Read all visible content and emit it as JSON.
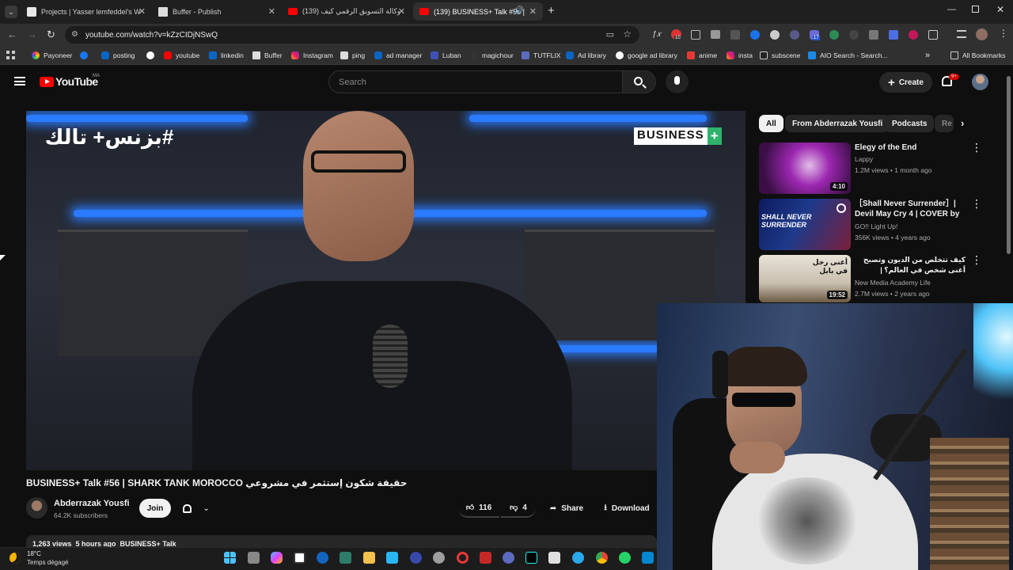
{
  "browser": {
    "tabs": [
      {
        "label": "Projects | Yasser lemfeddel's W"
      },
      {
        "label": "Buffer - Publish"
      },
      {
        "label": "(139) وكالة التسويق الرقمي كيف"
      },
      {
        "label": "(139) BUSINESS+ Talk #56 |"
      }
    ],
    "url": "youtube.com/watch?v=kZzCIDjNSwQ",
    "bookmarks": [
      "Payoneer",
      "posting",
      "youtube",
      "linkedin",
      "Buffer",
      "Instagram",
      "ping",
      "ad manager",
      "Luban",
      "magichour",
      "TUTFLIX",
      "Ad library",
      "google ad library",
      "anime",
      "insta",
      "subscene",
      "AIO Search - Search..."
    ],
    "all_bookmarks": "All Bookmarks",
    "ext_badges": {
      "red": "10",
      "blue": "17"
    }
  },
  "youtube": {
    "logo_text": "YouTube",
    "country_code": "MA",
    "search_placeholder": "Search",
    "create_label": "Create",
    "notif_badge": "9+"
  },
  "video": {
    "overlay_arabic": "#بزنس+ تالك",
    "overlay_brand": "BUSINESS",
    "overlay_plus": "+",
    "title": "BUSINESS+ Talk #56 | SHARK TANK MOROCCO حقيقة شكون إستثمر في مشروعي",
    "channel": "Abderrazak Yousfi",
    "subscribers": "64.2K subscribers",
    "join_label": "Join",
    "likes": "116",
    "dislikes": "4",
    "share_label": "Share",
    "download_label": "Download",
    "views_line": "1,263 views  5 hours ago  BUSINESS+ Talk"
  },
  "sidebar": {
    "chips": [
      "All",
      "From Abderrazak Yousfi",
      "Podcasts",
      "Re"
    ],
    "videos": [
      {
        "title": "Elegy of the End",
        "channel": "Lappy",
        "meta": "1.2M views • 1 month ago",
        "duration": "4:10"
      },
      {
        "title": "［Shall Never Surrender］| Devil May Cry 4 | COVER by G...",
        "channel": "GO!! Light Up!",
        "meta": "356K views • 4 years ago",
        "thumb_text": "SHALL NEVER SURRENDER"
      },
      {
        "title": "كيف تتخلص من الديون وتصبح أغنى شخص في العالم؟ | بوكافيين",
        "channel": "New Media Academy Life",
        "meta": "2.7M views • 2 years ago",
        "duration": "19:52",
        "thumb_text": "أغنى رجل في بابل"
      }
    ]
  },
  "taskbar": {
    "temperature": "18°C",
    "weather": "Temps dégagé"
  },
  "colors": {
    "yt_red": "#ff0000",
    "bg": "#0f0f0f",
    "neon_blue": "#2a7bff",
    "business_green": "#2fb36b"
  }
}
